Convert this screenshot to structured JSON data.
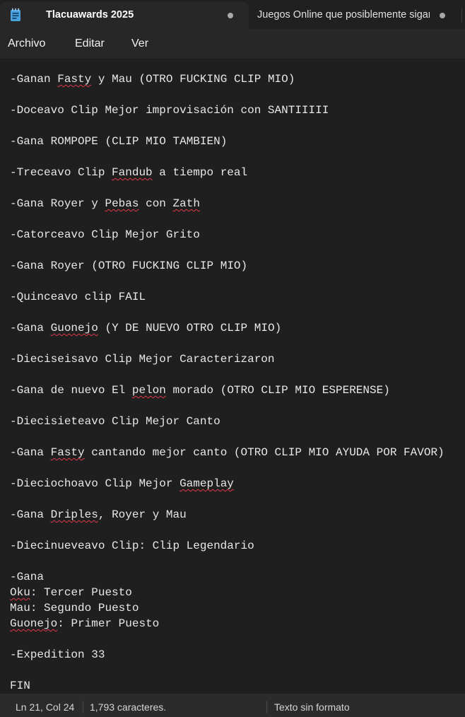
{
  "tabs": [
    {
      "title": "Tlacuawards 2025",
      "active": true
    },
    {
      "title": "Juegos Online que posiblemente sigan",
      "active": false
    }
  ],
  "menu": [
    "Archivo",
    "Editar",
    "Ver"
  ],
  "document": {
    "lines": [
      "-Ganan Fasty y Mau (OTRO FUCKING CLIP MIO)",
      "-Doceavo Clip Mejor improvisación con SANTIIIII",
      "-Gana ROMPOPE (CLIP MIO TAMBIEN)",
      "-Treceavo Clip Fandub a tiempo real",
      "-Gana Royer y Pebas con Zath",
      "-Catorceavo Clip Mejor Grito",
      "-Gana Royer (OTRO FUCKING CLIP MIO)",
      "-Quinceavo clip FAIL",
      "-Gana Guonejo (Y DE NUEVO OTRO CLIP MIO)",
      "-Dieciseisavo Clip Mejor Caracterizaron",
      "-Gana de nuevo El pelon morado (OTRO CLIP MIO ESPERENSE)",
      "-Diecisieteavo Clip Mejor Canto",
      "-Gana Fasty cantando mejor canto (OTRO CLIP MIO AYUDA POR FAVOR)",
      "-Dieciochoavo Clip Mejor Gameplay",
      "-Gana Driples, Royer y Mau",
      "-Diecinueveavo Clip: Clip Legendario",
      "-Gana",
      "Oku: Tercer Puesto",
      "Mau: Segundo Puesto",
      "Guonejo: Primer Puesto",
      "-Expedition 33",
      "FIN"
    ],
    "spellcheck_words": [
      "Fasty",
      "Fandub",
      "Pebas",
      "Zath",
      "Guonejo",
      "pelon",
      "Gameplay",
      "Driples",
      "Oku",
      "Expedition"
    ]
  },
  "status": {
    "position": "Ln 21, Col 24",
    "characters": "1,793 caracteres.",
    "format": "Texto sin formato"
  },
  "colors": {
    "background": "#1f1f1f",
    "chrome": "#272727",
    "spellcheck_underline": "#e0384a",
    "icon_blue": "#4aa3df"
  }
}
